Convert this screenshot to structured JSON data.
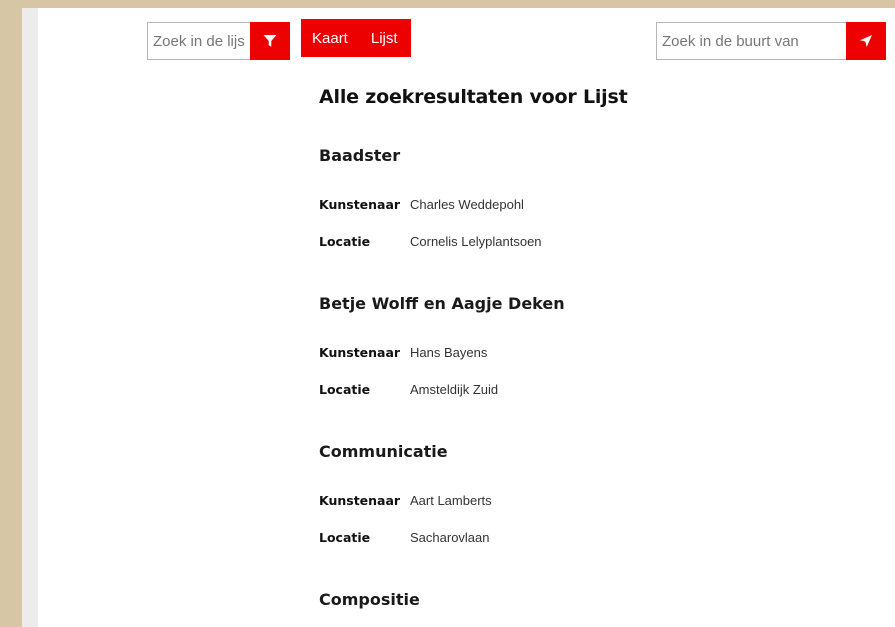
{
  "search_list": {
    "placeholder": "Zoek in de lijst"
  },
  "search_nearby": {
    "placeholder": "Zoek in de buurt van"
  },
  "view_toggle": {
    "map_label": "Kaart",
    "list_label": "Lijst"
  },
  "page_title": "Alle zoekresultaten voor Lijst",
  "labels": {
    "artist": "Kunstenaar",
    "location": "Locatie"
  },
  "results": [
    {
      "title": "Baadster",
      "artist": "Charles Weddepohl",
      "location": "Cornelis Lelyplantsoen"
    },
    {
      "title": "Betje Wolff en Aagje Deken",
      "artist": "Hans Bayens",
      "location": "Amsteldijk Zuid"
    },
    {
      "title": "Communicatie",
      "artist": "Aart Lamberts",
      "location": "Sacharovlaan"
    },
    {
      "title": "Compositie"
    }
  ],
  "colors": {
    "accent": "#ec0000",
    "background": "#d7c6a5",
    "gutter": "#ececec"
  },
  "icons": {
    "filter": "filter-icon",
    "locate": "location-arrow-icon"
  }
}
